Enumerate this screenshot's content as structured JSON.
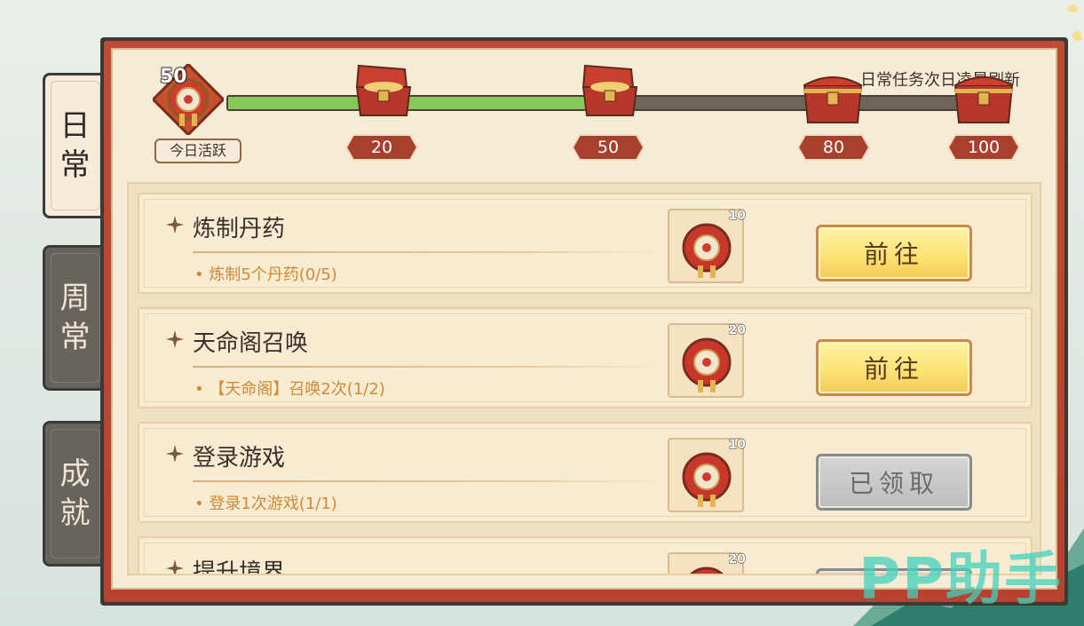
{
  "tabs": [
    {
      "label": "日常",
      "chars": [
        "日",
        "常"
      ],
      "active": true
    },
    {
      "label": "周常",
      "chars": [
        "周",
        "常"
      ],
      "active": false
    },
    {
      "label": "成就",
      "chars": [
        "成",
        "就"
      ],
      "active": false
    }
  ],
  "header": {
    "refresh_note": "日常任务次日凌晨刷新",
    "today_activity_value": "50",
    "today_activity_label": "今日活跃",
    "progress_fraction": 0.5
  },
  "milestones": [
    {
      "value": "20",
      "chest_state": "opened"
    },
    {
      "value": "50",
      "chest_state": "opened"
    },
    {
      "value": "80",
      "chest_state": "closed"
    },
    {
      "value": "100",
      "chest_state": "closed"
    }
  ],
  "tasks": [
    {
      "title": "炼制丹药",
      "desc": "• 炼制5个丹药(0/5)",
      "reward_count": "10",
      "button": "前往",
      "status": "go"
    },
    {
      "title": "天命阁召唤",
      "desc": "• 【天命阁】召唤2次(1/2)",
      "reward_count": "20",
      "button": "前往",
      "status": "go"
    },
    {
      "title": "登录游戏",
      "desc": "• 登录1次游戏(1/1)",
      "reward_count": "10",
      "button": "已领取",
      "status": "done"
    },
    {
      "title": "提升境界",
      "desc": "",
      "reward_count": "20",
      "button": "",
      "status": "done"
    }
  ],
  "watermark": "PP助手",
  "colors": {
    "progress_fill": "#86c95a",
    "accent_red": "#b8412f",
    "desc_orange": "#d08a36"
  }
}
